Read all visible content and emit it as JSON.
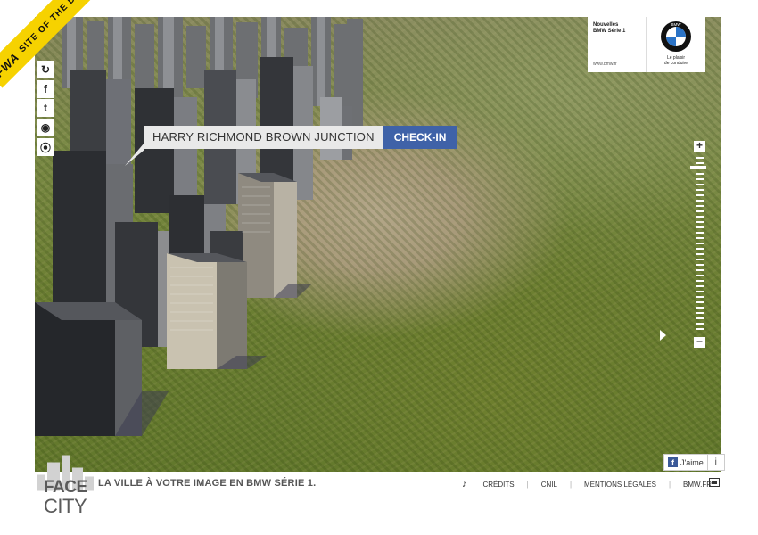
{
  "ribbon": {
    "logo": "FWA",
    "text": "SITE OF THE DAY"
  },
  "side_buttons": [
    {
      "name": "refresh-icon",
      "glyph": "↻"
    },
    {
      "name": "facebook-icon",
      "glyph": "f"
    },
    {
      "name": "twitter-icon",
      "glyph": "t"
    },
    {
      "name": "camera-icon",
      "glyph": "◉"
    },
    {
      "name": "location-icon",
      "glyph": "⦿"
    }
  ],
  "ad": {
    "line1": "Nouvelles",
    "line2": "BMW Série 1",
    "url": "www.bmw.fr",
    "brand": "BMW",
    "slogan_1": "Le plaisir",
    "slogan_2": "de conduire"
  },
  "location": {
    "name": "HARRY RICHMOND BROWN JUNCTION",
    "checkin_label": "CHECK-IN"
  },
  "zoom": {
    "plus": "+",
    "minus": "−",
    "level": 0.95
  },
  "like": {
    "fb_glyph": "f",
    "label": "J'aime",
    "info": "i"
  },
  "footer": {
    "brand_face": "FACE",
    "brand_city": "CITY",
    "tagline": "LA VILLE À VOTRE IMAGE EN BMW SÉRIE 1.",
    "music_glyph": "♪",
    "links": [
      "CRÉDITS",
      "CNIL",
      "MENTIONS LÉGALES",
      "BMW.FR"
    ]
  },
  "colors": {
    "checkin": "#3f62a8",
    "ribbon": "#f6d200",
    "facebook": "#3b5998"
  }
}
